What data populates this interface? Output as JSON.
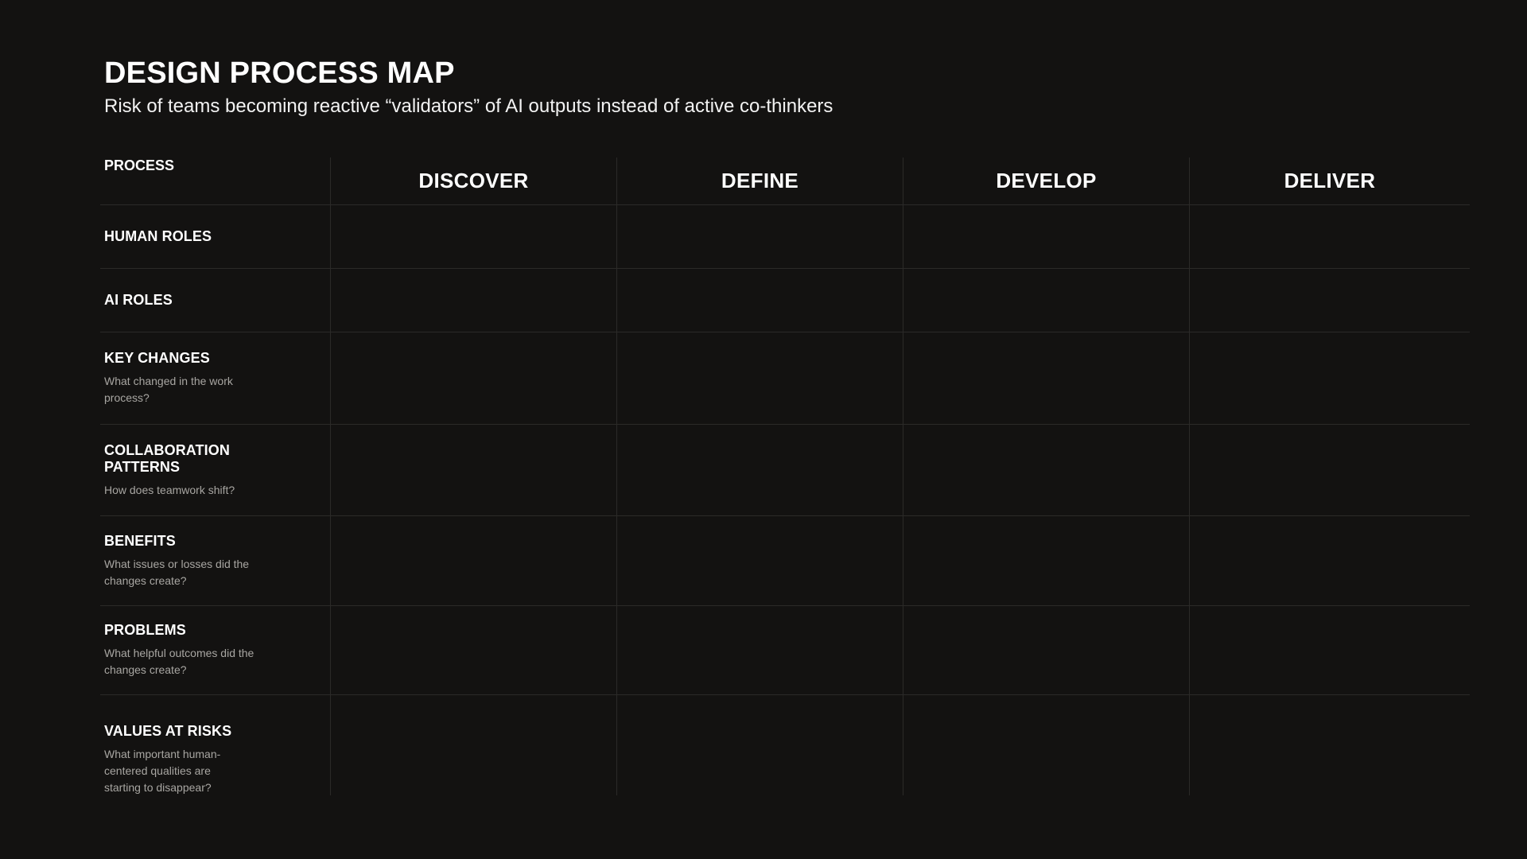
{
  "header": {
    "title": "DESIGN PROCESS MAP",
    "subtitle": "Risk of teams becoming reactive “validators” of AI outputs instead of active co-thinkers"
  },
  "table": {
    "corner_label": "PROCESS",
    "columns": [
      "DISCOVER",
      "DEFINE",
      "DEVELOP",
      "DELIVER"
    ],
    "rows": [
      {
        "label": "HUMAN ROLES",
        "description": ""
      },
      {
        "label": "AI ROLES",
        "description": ""
      },
      {
        "label": "KEY CHANGES",
        "description": "What changed in the work process?"
      },
      {
        "label": "COLLABORATION PATTERNS",
        "description": "How does teamwork shift?"
      },
      {
        "label": "BENEFITS",
        "description": "What issues or losses did the changes create?"
      },
      {
        "label": "PROBLEMS",
        "description": "What helpful outcomes did the changes create?"
      },
      {
        "label": "VALUES AT RISKS",
        "description": "What important human-centered qualities are starting to disappear?"
      }
    ]
  },
  "colors": {
    "background": "#131211",
    "grid_line": "#2b2a28",
    "text_primary": "#ffffff",
    "text_secondary": "#a8a6a2"
  }
}
